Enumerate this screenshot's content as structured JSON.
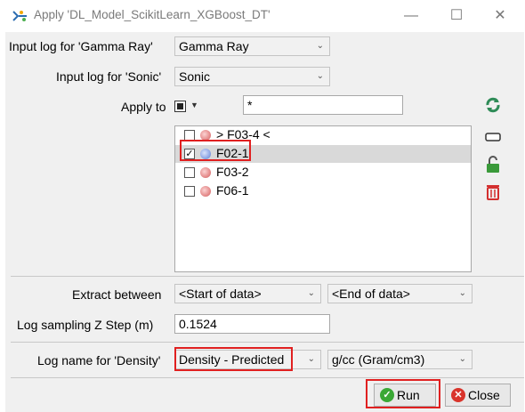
{
  "window": {
    "title": "Apply 'DL_Model_ScikitLearn_XGBoost_DT'",
    "minimize_glyph": "—",
    "maximize_glyph": "☐",
    "close_glyph": "✕"
  },
  "form": {
    "gamma_label": "Input log for 'Gamma Ray'",
    "gamma_value": "Gamma Ray",
    "sonic_label": "Input log for 'Sonic'",
    "sonic_value": "Sonic",
    "apply_to_label": "Apply to",
    "filter_value": "*",
    "extract_label": "Extract between",
    "extract_start": "<Start of data>",
    "extract_end": "<End of data>",
    "zstep_label": "Log sampling Z Step (m)",
    "zstep_value": "0.1524",
    "density_label": "Log name for 'Density'",
    "density_value": "Density - Predicted",
    "density_unit": "g/cc (Gram/cm3)"
  },
  "wells": [
    {
      "label": "> F03-4 <",
      "checked": false,
      "selected": false,
      "icon": "well-red"
    },
    {
      "label": "F02-1",
      "checked": true,
      "selected": true,
      "icon": "well-blue"
    },
    {
      "label": "F03-2",
      "checked": false,
      "selected": false,
      "icon": "well-red"
    },
    {
      "label": "F06-1",
      "checked": false,
      "selected": false,
      "icon": "well-red"
    }
  ],
  "buttons": {
    "run_label": "Run",
    "close_label": "Close"
  },
  "colors": {
    "highlight": "#e02020",
    "run_icon": "#3aa835",
    "close_icon": "#d9342b"
  }
}
